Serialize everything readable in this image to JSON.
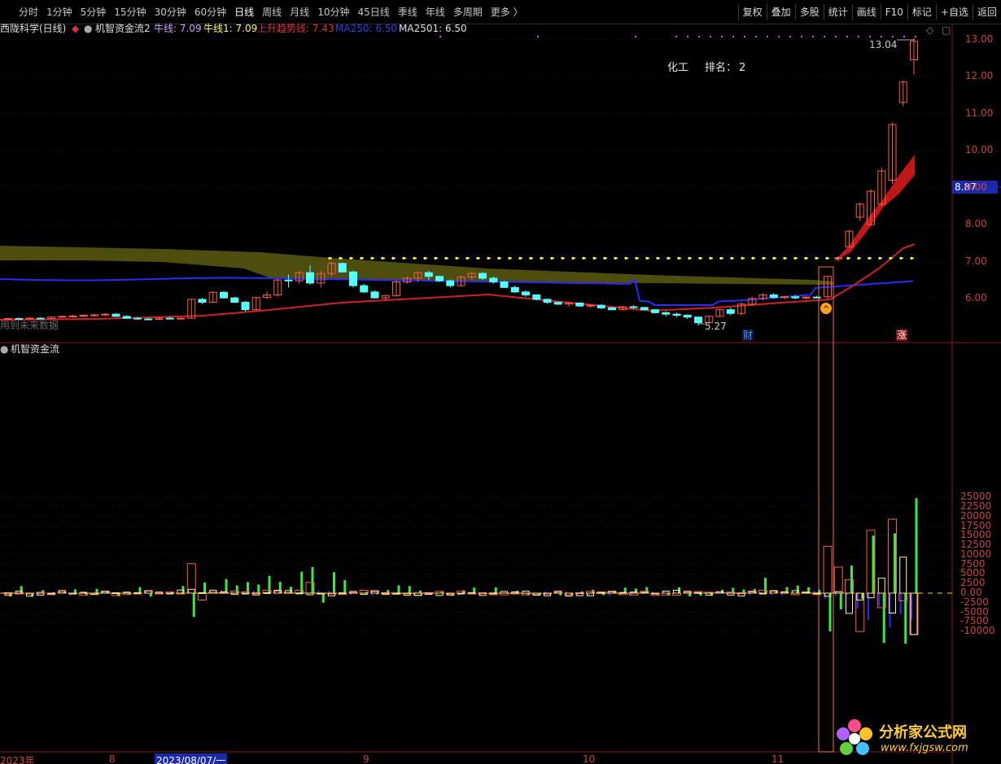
{
  "toolbar": {
    "periods": [
      "分时",
      "1分钟",
      "5分钟",
      "15分钟",
      "30分钟",
      "60分钟",
      "日线",
      "周线",
      "月线",
      "10分钟",
      "45日线",
      "季线",
      "年线",
      "多周期",
      "更多 〉"
    ],
    "active_period": "日线",
    "right_tools": [
      "复权",
      "叠加",
      "多股",
      "统计",
      "画线",
      "F10",
      "标记",
      "+自选",
      "返回"
    ]
  },
  "price_legend": {
    "stock_name": "西陇科学(日线)",
    "indicator_name": "机智资金流2",
    "cow_line_label": "牛线: 7.09",
    "cow_line1_label": "牛线1: 7.09",
    "up_trend_label": "上升趋势线: 7.43",
    "ma250_label": "MA250: 6.50",
    "ma2501_label": "MA2501: 6.50"
  },
  "annotations": {
    "industry": "化工",
    "rank_label": "排名：",
    "rank_value": "2",
    "high_label": "13.04",
    "low_label": "5.27",
    "cai_marker": "财",
    "zhang_marker": "涨",
    "left_text": "用到未来数据"
  },
  "current_price": "8.87",
  "price_axis": [
    "13.00",
    "12.00",
    "11.00",
    "10.00",
    "9.00",
    "8.00",
    "7.00",
    "6.00"
  ],
  "volume_panel": {
    "title": "机智资金流",
    "axis": [
      "25000",
      "22500",
      "20000",
      "17500",
      "15000",
      "12500",
      "10000",
      "7500",
      "5000",
      "2500",
      "0.00",
      "-2500",
      "-5000",
      "-7500",
      "-10000"
    ]
  },
  "date_axis": {
    "labels": [
      "2023年",
      "8",
      "2023/08/07/一",
      "9",
      "10",
      "11"
    ]
  },
  "watermark": {
    "cn": "分析家公式网",
    "url": "www.fxjgsw.com"
  },
  "colors": {
    "up": "#ff5a4a",
    "down": "#54ffff",
    "ma_blue": "#2a2aff",
    "trend_red": "#d42020",
    "band_olive": "#5a5a10",
    "cow_yellow": "#ffff44",
    "green_bar": "#3ee83e"
  },
  "chart_data": {
    "type": "candlestick",
    "candles": [
      [
        5.45,
        5.48,
        5.42,
        5.46
      ],
      [
        5.46,
        5.49,
        5.43,
        5.45
      ],
      [
        5.45,
        5.5,
        5.43,
        5.47
      ],
      [
        5.47,
        5.5,
        5.44,
        5.46
      ],
      [
        5.46,
        5.51,
        5.44,
        5.5
      ],
      [
        5.5,
        5.54,
        5.47,
        5.52
      ],
      [
        5.52,
        5.56,
        5.49,
        5.53
      ],
      [
        5.53,
        5.57,
        5.5,
        5.55
      ],
      [
        5.55,
        5.6,
        5.52,
        5.56
      ],
      [
        5.56,
        5.6,
        5.52,
        5.58
      ],
      [
        5.58,
        5.61,
        5.5,
        5.52
      ],
      [
        5.52,
        5.55,
        5.45,
        5.47
      ],
      [
        5.47,
        5.5,
        5.43,
        5.45
      ],
      [
        5.45,
        5.48,
        5.42,
        5.44
      ],
      [
        5.44,
        5.5,
        5.42,
        5.47
      ],
      [
        5.47,
        5.52,
        5.44,
        5.45
      ],
      [
        5.45,
        5.5,
        5.43,
        5.47
      ],
      [
        5.47,
        5.99,
        5.45,
        5.98
      ],
      [
        5.98,
        6.02,
        5.85,
        5.9
      ],
      [
        5.9,
        6.2,
        5.88,
        6.17
      ],
      [
        6.17,
        6.2,
        6.0,
        6.02
      ],
      [
        6.02,
        6.05,
        5.88,
        5.9
      ],
      [
        5.9,
        5.93,
        5.65,
        5.7
      ],
      [
        5.7,
        6.05,
        5.68,
        6.03
      ],
      [
        6.03,
        6.2,
        5.98,
        6.1
      ],
      [
        6.1,
        6.55,
        6.05,
        6.5
      ],
      [
        6.5,
        6.65,
        6.3,
        6.48
      ],
      [
        6.48,
        6.75,
        6.4,
        6.7
      ],
      [
        6.7,
        6.9,
        6.38,
        6.42
      ],
      [
        6.42,
        6.75,
        6.3,
        6.68
      ],
      [
        6.68,
        7.0,
        6.6,
        6.95
      ],
      [
        6.95,
        6.98,
        6.7,
        6.72
      ],
      [
        6.72,
        6.75,
        6.3,
        6.35
      ],
      [
        6.35,
        6.4,
        6.15,
        6.18
      ],
      [
        6.18,
        6.22,
        6.0,
        6.02
      ],
      [
        6.02,
        6.1,
        5.95,
        6.08
      ],
      [
        6.08,
        6.5,
        6.05,
        6.45
      ],
      [
        6.45,
        6.6,
        6.4,
        6.55
      ],
      [
        6.55,
        6.72,
        6.45,
        6.7
      ],
      [
        6.7,
        6.75,
        6.5,
        6.6
      ],
      [
        6.6,
        6.62,
        6.45,
        6.48
      ],
      [
        6.48,
        6.52,
        6.3,
        6.35
      ],
      [
        6.35,
        6.62,
        6.32,
        6.58
      ],
      [
        6.58,
        6.72,
        6.5,
        6.68
      ],
      [
        6.68,
        6.72,
        6.5,
        6.55
      ],
      [
        6.55,
        6.6,
        6.4,
        6.45
      ],
      [
        6.45,
        6.48,
        6.3,
        6.3
      ],
      [
        6.3,
        6.35,
        6.15,
        6.18
      ],
      [
        6.18,
        6.22,
        6.05,
        6.1
      ],
      [
        6.1,
        6.12,
        5.95,
        5.98
      ],
      [
        5.98,
        6.0,
        5.86,
        5.9
      ],
      [
        5.9,
        5.92,
        5.82,
        5.85
      ],
      [
        5.85,
        5.9,
        5.78,
        5.88
      ],
      [
        5.88,
        5.9,
        5.78,
        5.8
      ],
      [
        5.8,
        5.85,
        5.75,
        5.82
      ],
      [
        5.82,
        5.85,
        5.72,
        5.75
      ],
      [
        5.75,
        5.78,
        5.68,
        5.7
      ],
      [
        5.7,
        5.8,
        5.68,
        5.78
      ],
      [
        5.78,
        5.82,
        5.72,
        5.76
      ],
      [
        5.76,
        5.78,
        5.68,
        5.7
      ],
      [
        5.7,
        5.72,
        5.6,
        5.62
      ],
      [
        5.62,
        5.66,
        5.52,
        5.58
      ],
      [
        5.58,
        5.62,
        5.5,
        5.55
      ],
      [
        5.55,
        5.58,
        5.45,
        5.5
      ],
      [
        5.5,
        5.52,
        5.27,
        5.35
      ],
      [
        5.35,
        5.55,
        5.3,
        5.52
      ],
      [
        5.52,
        5.72,
        5.5,
        5.7
      ],
      [
        5.7,
        5.75,
        5.55,
        5.6
      ],
      [
        5.6,
        5.9,
        5.55,
        5.85
      ],
      [
        5.85,
        6.05,
        5.8,
        6.0
      ],
      [
        6.0,
        6.15,
        5.95,
        6.1
      ],
      [
        6.1,
        6.15,
        6.0,
        6.03
      ],
      [
        6.03,
        6.08,
        5.98,
        6.05
      ],
      [
        6.05,
        6.1,
        5.98,
        6.02
      ],
      [
        6.02,
        6.06,
        5.98,
        6.04
      ],
      [
        6.04,
        6.08,
        6.0,
        6.03
      ],
      [
        6.05,
        6.62,
        6.0,
        6.6
      ],
      [
        7.08,
        7.12,
        7.0,
        7.1
      ],
      [
        7.4,
        7.85,
        7.4,
        7.82
      ],
      [
        8.2,
        8.6,
        8.1,
        8.55
      ],
      [
        8.0,
        8.95,
        7.95,
        8.9
      ],
      [
        8.55,
        9.55,
        8.5,
        9.45
      ],
      [
        9.2,
        10.75,
        9.1,
        10.7
      ],
      [
        11.3,
        11.9,
        11.2,
        11.85
      ],
      [
        12.45,
        13.04,
        12.05,
        12.95
      ]
    ],
    "vol_bars": "fund flow oscillator, range -10000 to 25000"
  }
}
